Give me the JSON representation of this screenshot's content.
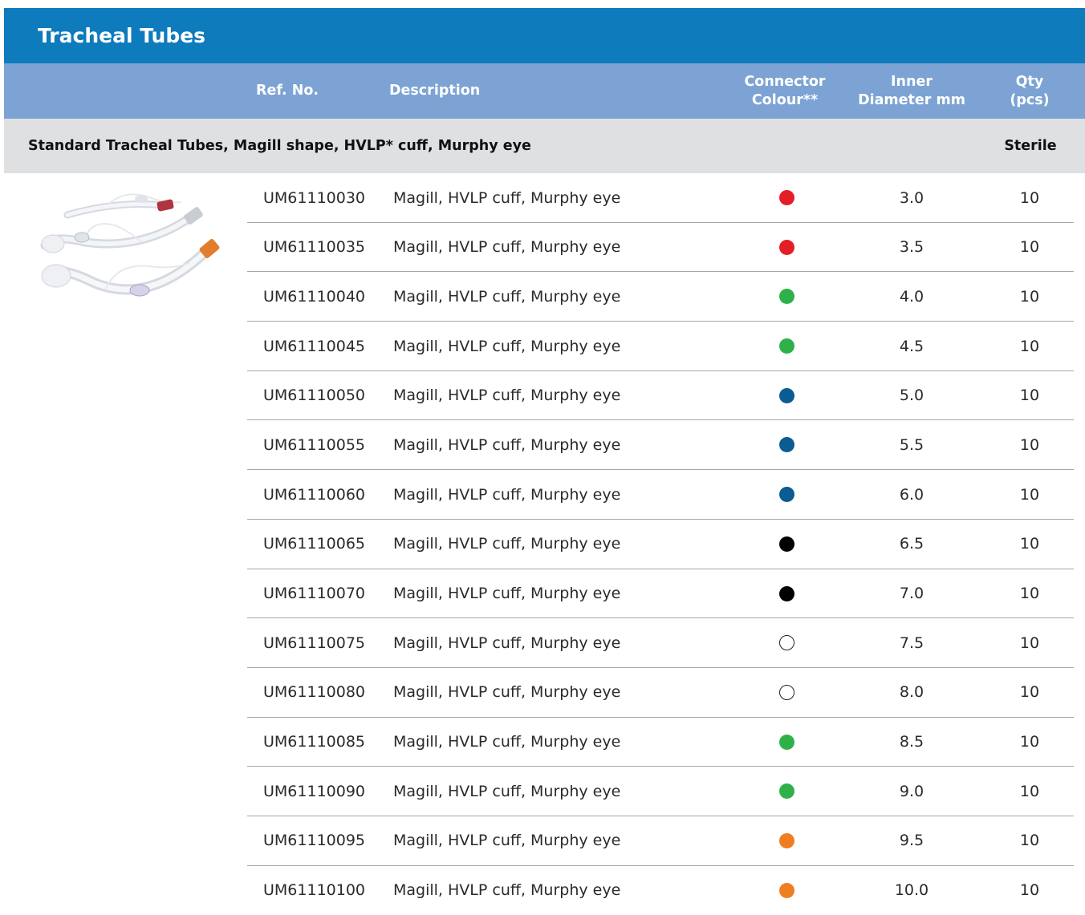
{
  "title": "Tracheal Tubes",
  "headers": {
    "ref_no": "Ref. No.",
    "description": "Description",
    "connector_line1": "Connector",
    "connector_line2": "Colour**",
    "inner_line1": "Inner",
    "inner_line2": "Diameter mm",
    "qty_line1": "Qty",
    "qty_line2": "(pcs)"
  },
  "section": {
    "title": "Standard Tracheal Tubes,  Magill shape, HVLP* cuff, Murphy eye",
    "sterile": "Sterile"
  },
  "product_image": {
    "icon": "tracheal-tubes-image",
    "tube_colors": [
      "#c0394f",
      "#b0b4bd",
      "#e07e2e"
    ]
  },
  "colors": {
    "red": "#e41e26",
    "green": "#2fb14a",
    "blue": "#0a5c93",
    "black": "#000000",
    "white": "#ffffff",
    "orange": "#ef7d22"
  },
  "rows": [
    {
      "ref": "UM61110030",
      "description": "Magill, HVLP cuff, Murphy eye",
      "connector_colour": "red",
      "inner_diameter": "3.0",
      "qty": "10"
    },
    {
      "ref": "UM61110035",
      "description": "Magill, HVLP cuff, Murphy eye",
      "connector_colour": "red",
      "inner_diameter": "3.5",
      "qty": "10"
    },
    {
      "ref": "UM61110040",
      "description": "Magill, HVLP cuff, Murphy eye",
      "connector_colour": "green",
      "inner_diameter": "4.0",
      "qty": "10"
    },
    {
      "ref": "UM61110045",
      "description": "Magill, HVLP cuff, Murphy eye",
      "connector_colour": "green",
      "inner_diameter": "4.5",
      "qty": "10"
    },
    {
      "ref": "UM61110050",
      "description": "Magill, HVLP cuff, Murphy eye",
      "connector_colour": "blue",
      "inner_diameter": "5.0",
      "qty": "10"
    },
    {
      "ref": "UM61110055",
      "description": "Magill, HVLP cuff, Murphy eye",
      "connector_colour": "blue",
      "inner_diameter": "5.5",
      "qty": "10"
    },
    {
      "ref": "UM61110060",
      "description": "Magill, HVLP cuff, Murphy eye",
      "connector_colour": "blue",
      "inner_diameter": "6.0",
      "qty": "10"
    },
    {
      "ref": "UM61110065",
      "description": "Magill, HVLP cuff, Murphy eye",
      "connector_colour": "black",
      "inner_diameter": "6.5",
      "qty": "10"
    },
    {
      "ref": "UM61110070",
      "description": "Magill, HVLP cuff, Murphy eye",
      "connector_colour": "black",
      "inner_diameter": "7.0",
      "qty": "10"
    },
    {
      "ref": "UM61110075",
      "description": "Magill, HVLP cuff, Murphy eye",
      "connector_colour": "white",
      "inner_diameter": "7.5",
      "qty": "10"
    },
    {
      "ref": "UM61110080",
      "description": "Magill, HVLP cuff, Murphy eye",
      "connector_colour": "white",
      "inner_diameter": "8.0",
      "qty": "10"
    },
    {
      "ref": "UM61110085",
      "description": "Magill, HVLP cuff, Murphy eye",
      "connector_colour": "green",
      "inner_diameter": "8.5",
      "qty": "10"
    },
    {
      "ref": "UM61110090",
      "description": "Magill, HVLP cuff, Murphy eye",
      "connector_colour": "green",
      "inner_diameter": "9.0",
      "qty": "10"
    },
    {
      "ref": "UM61110095",
      "description": "Magill, HVLP cuff, Murphy eye",
      "connector_colour": "orange",
      "inner_diameter": "9.5",
      "qty": "10"
    },
    {
      "ref": "UM61110100",
      "description": "Magill, HVLP cuff, Murphy eye",
      "connector_colour": "orange",
      "inner_diameter": "10.0",
      "qty": "10"
    }
  ]
}
